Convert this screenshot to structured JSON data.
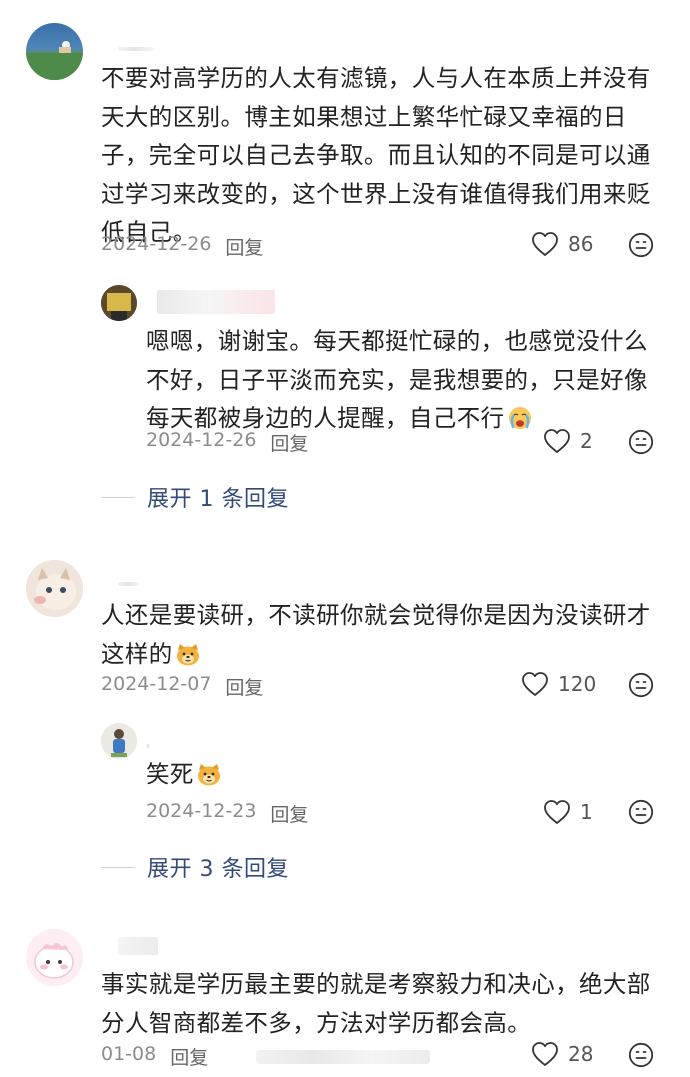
{
  "comments": [
    {
      "text": "不要对高学历的人太有滤镜，人与人在本质上并没有天大的区别。博主如果想过上繁华忙碌又幸福的日子，完全可以自己去争取。而且认知的不同是可以通过学习来改变的，这个世界上没有谁值得我们用来贬低自己。",
      "date": "2024-12-26",
      "reply": "回复",
      "likes": "86",
      "replies": [
        {
          "text": "嗯嗯，谢谢宝。每天都挺忙碌的，也感觉没什么不好，日子平淡而充实，是我想要的，只是好像每天都被身边的人提醒，自己不行",
          "date": "2024-12-26",
          "reply": "回复",
          "likes": "2"
        }
      ],
      "expand": "展开 1 条回复"
    },
    {
      "text": "人还是要读研，不读研你就会觉得你是因为没读研才这样的",
      "date": "2024-12-07",
      "reply": "回复",
      "likes": "120",
      "replies": [
        {
          "text": "笑死",
          "date": "2024-12-23",
          "reply": "回复",
          "likes": "1"
        }
      ],
      "expand": "展开 3 条回复"
    },
    {
      "text": "事实就是学历最主要的就是考察毅力和决心，绝大部分人智商都差不多，方法对学历都会高。",
      "date": "01-08",
      "reply": "回复",
      "likes": "28"
    }
  ],
  "icons": {
    "like": "heart-outline-icon",
    "emoji": "smile-face-icon",
    "crying": "crying-face-emoji",
    "dog": "dog-face-emoji"
  },
  "colors": {
    "text": "#222222",
    "meta": "#8c8c8c",
    "expand": "#33497a"
  }
}
